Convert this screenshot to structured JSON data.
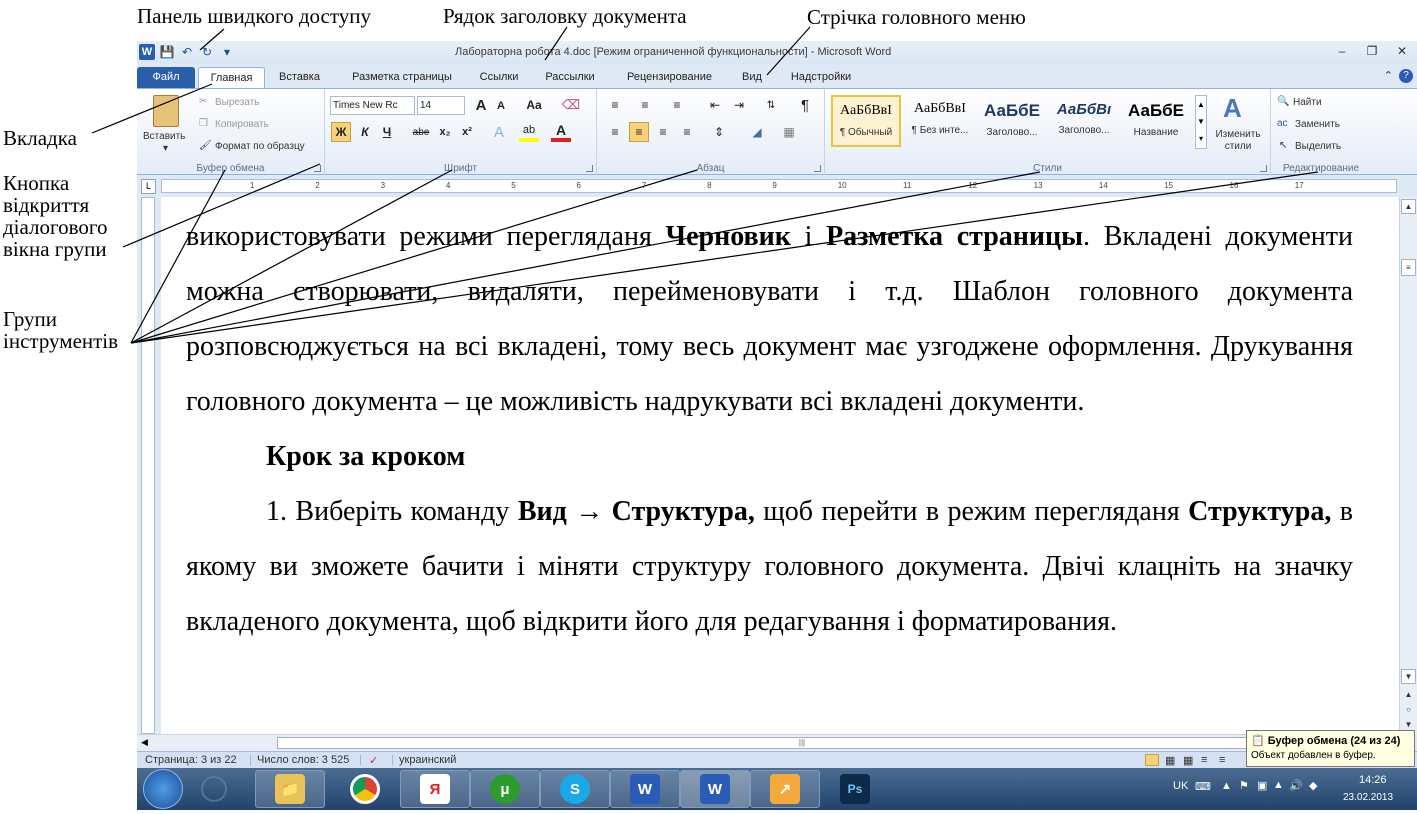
{
  "annotations": {
    "quick_access": "Панель швидкого доступу",
    "doc_title_row": "Рядок заголовку документа",
    "ribbon": "Стрічка головного меню",
    "tab": "Вкладка",
    "dialog_launcher_1": "Кнопка",
    "dialog_launcher_2": "відкриття",
    "dialog_launcher_3": "діалогового",
    "dialog_launcher_4": "вікна групи",
    "groups_1": "Групи",
    "groups_2": "інструментів"
  },
  "window": {
    "title": "Лабораторна робота 4.doc [Режим ограниченной функциональности]  -  Microsoft Word",
    "app_icon": "W"
  },
  "tabs": {
    "file": "Файл",
    "home": "Главная",
    "insert": "Вставка",
    "layout": "Разметка страницы",
    "refs": "Ссылки",
    "mailings": "Рассылки",
    "review": "Рецензирование",
    "view": "Вид",
    "addins": "Надстройки"
  },
  "ribbon": {
    "clipboard": {
      "paste": "Вставить",
      "cut": "Вырезать",
      "copy": "Копировать",
      "format_painter": "Формат по образцу",
      "label": "Буфер обмена"
    },
    "font": {
      "name": "Times New Rc",
      "size": "14",
      "label": "Шрифт",
      "bold": "Ж",
      "italic": "К",
      "underline": "Ч",
      "strike": "abe",
      "sub": "x₂",
      "sup": "x²",
      "change_case": "Aa",
      "grow": "A",
      "shrink": "A"
    },
    "paragraph": {
      "label": "Абзац",
      "pilcrow": "¶"
    },
    "styles": {
      "label": "Стили",
      "items": [
        {
          "sample": "АаБбВвI",
          "name": "¶ Обычный"
        },
        {
          "sample": "АаБбВвI",
          "name": "¶ Без инте..."
        },
        {
          "sample": "АаБбЕ",
          "name": "Заголово..."
        },
        {
          "sample": "АаБбВı",
          "name": "Заголово..."
        },
        {
          "sample": "АаБбЕ",
          "name": "Название"
        }
      ],
      "change_1": "Изменить",
      "change_2": "стили"
    },
    "editing": {
      "label": "Редактирование",
      "find": "Найти",
      "replace": "Заменить",
      "select": "Выделить"
    }
  },
  "ruler": {
    "marks": [
      "1",
      "2",
      "3",
      "4",
      "5",
      "6",
      "7",
      "8",
      "9",
      "10",
      "11",
      "12",
      "13",
      "14",
      "15",
      "16",
      "17"
    ]
  },
  "document": {
    "p1_a": "використовувати режими перегляданя ",
    "p1_b1": "Черновик",
    "p1_c": " і ",
    "p1_b2": "Разметка страницы",
    "p1_d": ". Вкладені документи можна створювати, видаляти, перейменовувати і т.д. Шаблон головного документа розповсюджується на всі вкладені, тому весь документ має узгоджене оформлення. Друкування головного документа – це можливість надрукувати всі вкладені документи.",
    "heading": "Крок за кроком",
    "p2_a": "1. Виберіть команду ",
    "p2_b1": "Вид → Структура,",
    "p2_c": " щоб перейти в режим перегляданя ",
    "p2_b2": "Структура,",
    "p2_d": " в якому ви зможете бачити і міняти структуру головного документа. Двічі клацніть на значку вкладеного документа, щоб відкрити його для редагування і форматирования."
  },
  "status": {
    "page": "Страница: 3 из 22",
    "words": "Число слов: 3 525",
    "lang": "украинский"
  },
  "tooltip": {
    "title": "Буфер обмена (24 из 24)",
    "text": "Объект добавлен в буфер."
  },
  "taskbar": {
    "lang": "UK",
    "time": "14:26",
    "date": "23.02.2013",
    "yandex": "Я",
    "ps": "Ps",
    "word": "W"
  }
}
